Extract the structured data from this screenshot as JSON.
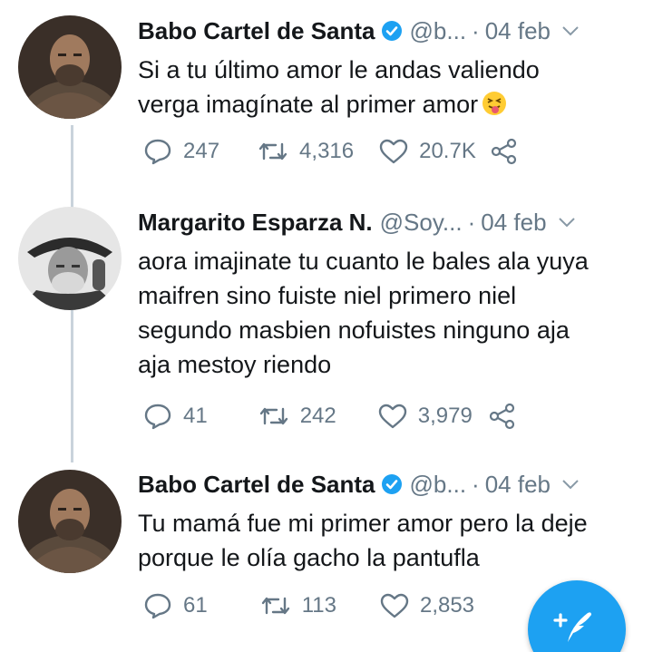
{
  "tweets": [
    {
      "name": "Babo Cartel de Santa",
      "handle": "@b...",
      "separator": "·",
      "time": "04 feb",
      "verified": true,
      "text": "Si a tu último amor le andas valiendo\nverga imagínate al primer amor",
      "emoji": "squinting-face-with-tongue-icon",
      "replies": "247",
      "retweets": "4,316",
      "likes": "20.7K"
    },
    {
      "name": "Margarito Esparza N.",
      "handle": "@Soy...",
      "separator": "·",
      "time": "04 feb",
      "verified": false,
      "text": "aora imajinate tu cuanto le bales ala yuya\nmaifren sino fuiste niel primero niel\nsegundo masbien nofuistes ninguno aja\naja mestoy riendo",
      "replies": "41",
      "retweets": "242",
      "likes": "3,979"
    },
    {
      "name": "Babo Cartel de Santa",
      "handle": "@b...",
      "separator": "·",
      "time": "04 feb",
      "verified": true,
      "text": "Tu mamá fue mi primer amor pero la deje\nporque le olía gacho la pantufla",
      "replies": "61",
      "retweets": "113",
      "likes": "2,853"
    }
  ],
  "colors": {
    "accent": "#1da1f2",
    "muted": "#657786",
    "text": "#14171a",
    "thread_line": "#c9d3db"
  },
  "compose_button_icon": "compose-tweet-icon"
}
